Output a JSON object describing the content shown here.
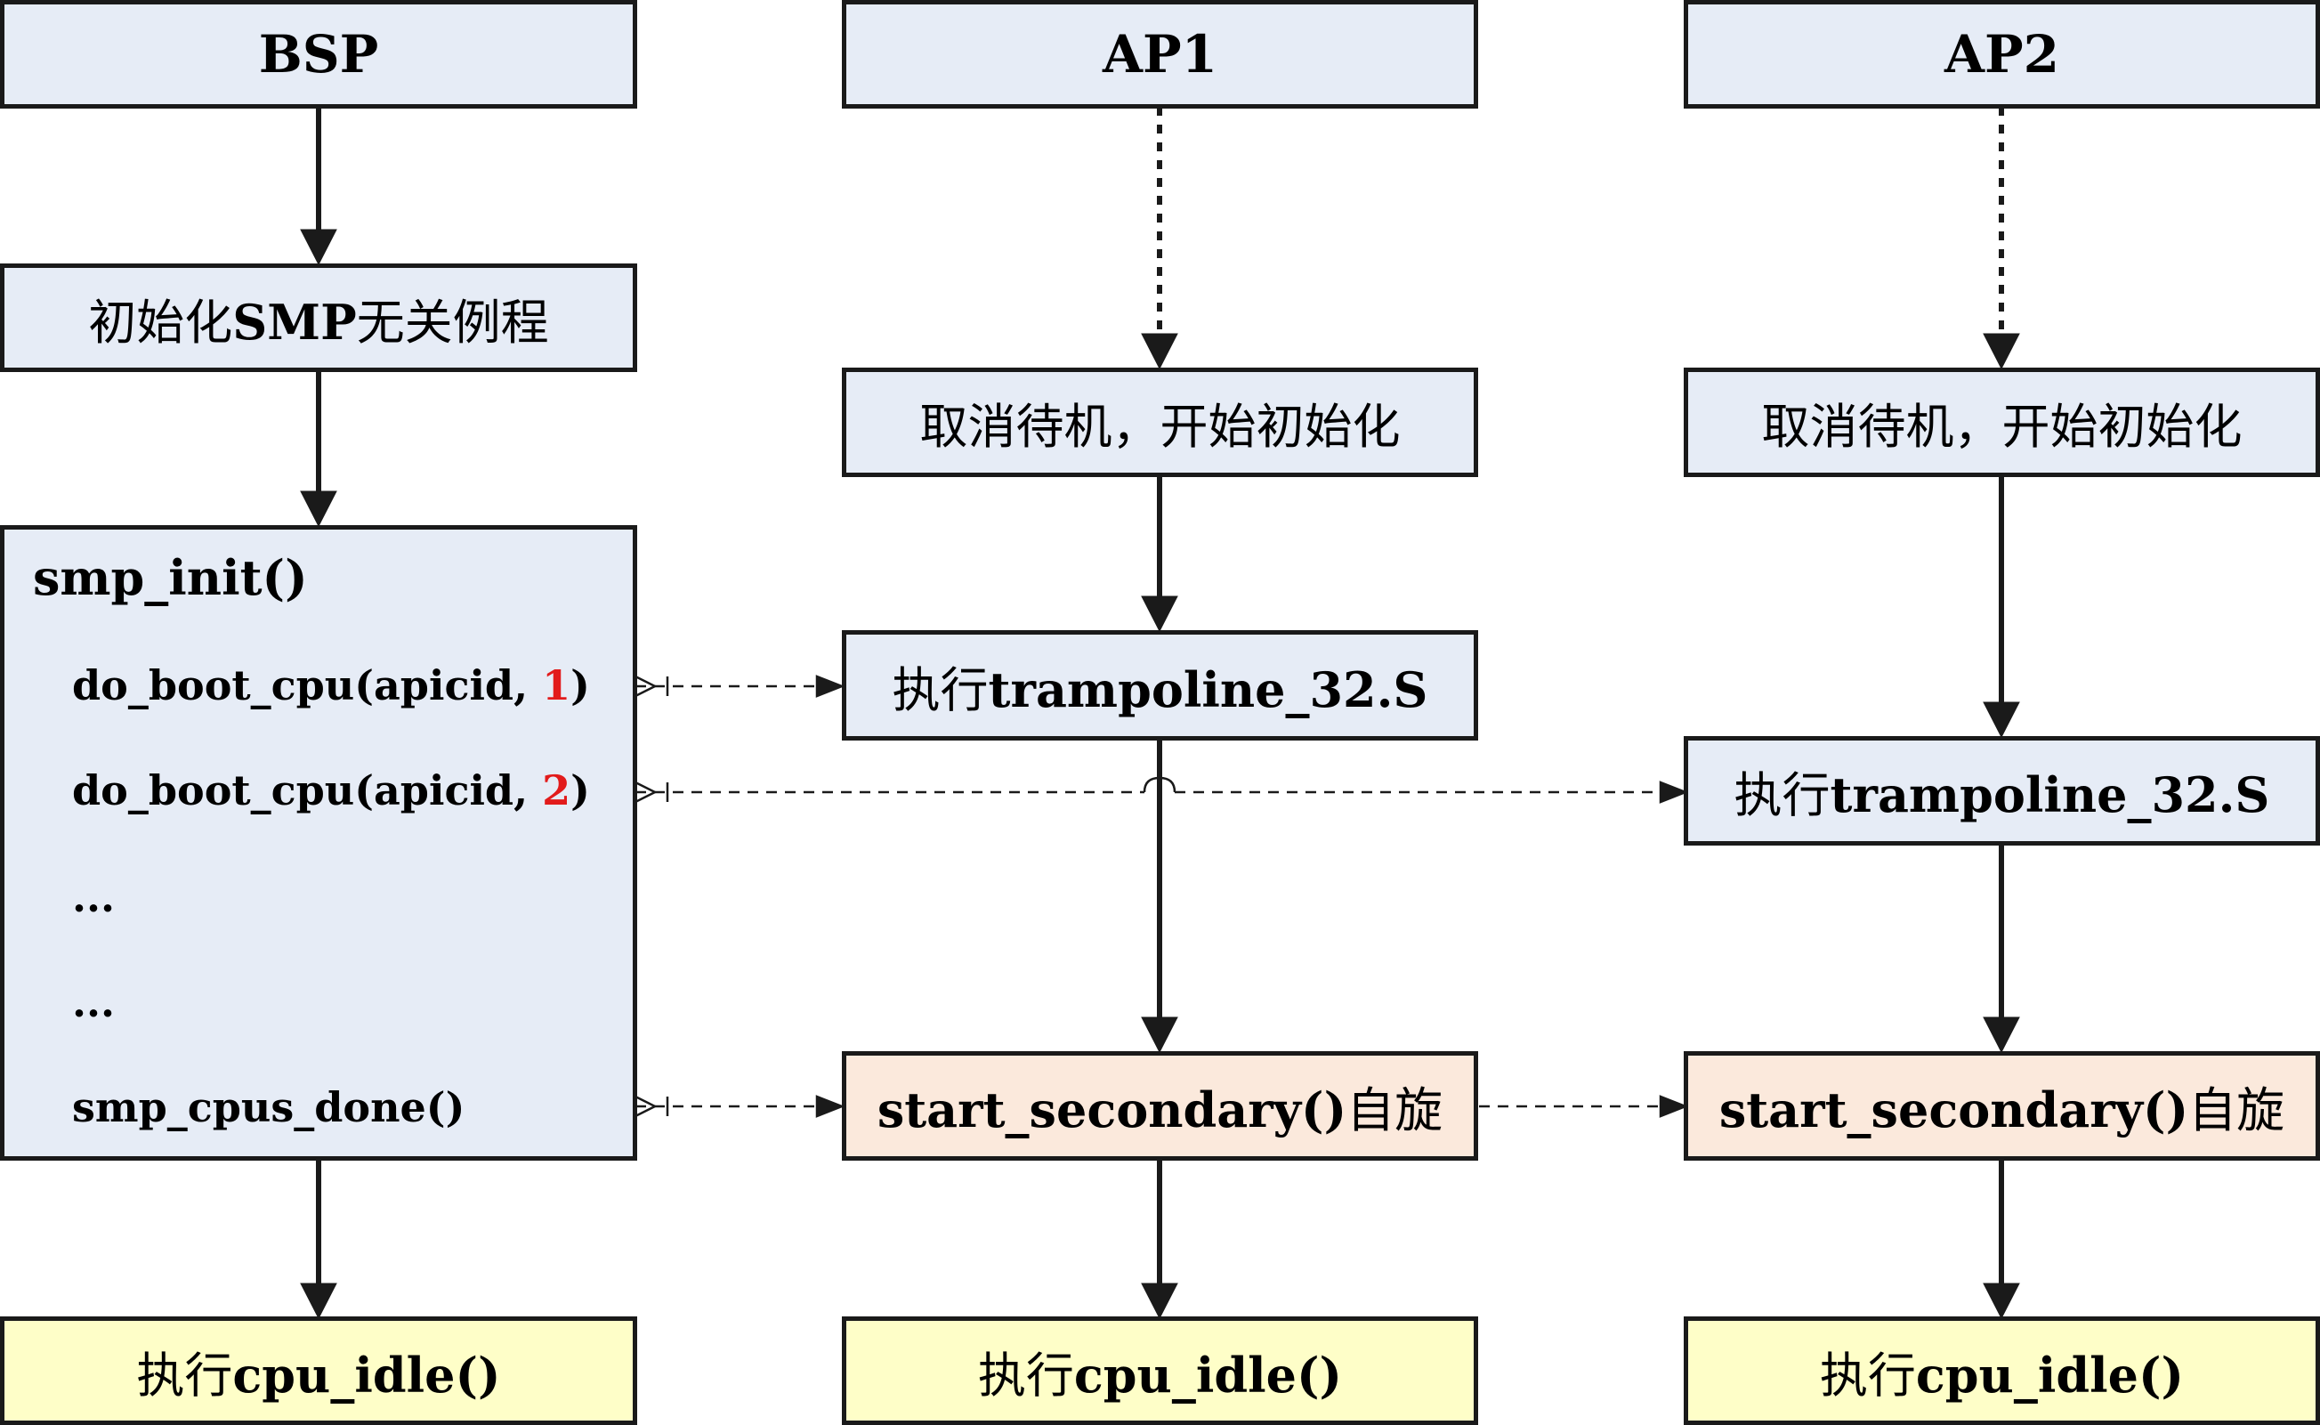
{
  "columns": {
    "bsp": {
      "header": "BSP",
      "init_step": {
        "cn": "初始化",
        "bold": "SMP",
        "cn2": "无关例程"
      },
      "block": {
        "title": "smp_init()",
        "lines": [
          {
            "pre": "do_boot_cpu(apicid, ",
            "num": "1",
            "post": ")"
          },
          {
            "pre": "do_boot_cpu(apicid, ",
            "num": "2",
            "post": ")"
          },
          {
            "text": "..."
          },
          {
            "text": "..."
          },
          {
            "text": "smp_cpus_done()"
          }
        ]
      },
      "idle": {
        "cn": "执行",
        "bold": "cpu_idle()"
      }
    },
    "ap1": {
      "header": "AP1",
      "wake": "取消待机，开始初始化",
      "tramp": {
        "cn": "执行",
        "bold": "trampoline_32.S"
      },
      "spin": {
        "bold": "start_secondary()",
        "cn": "自旋"
      },
      "idle": {
        "cn": "执行",
        "bold": "cpu_idle()"
      }
    },
    "ap2": {
      "header": "AP2",
      "wake": "取消待机，开始初始化",
      "tramp": {
        "cn": "执行",
        "bold": "trampoline_32.S"
      },
      "spin": {
        "bold": "start_secondary()",
        "cn": "自旋"
      },
      "idle": {
        "cn": "执行",
        "bold": "cpu_idle()"
      }
    }
  },
  "colors": {
    "box_blue": "#e6ecf6",
    "box_orange": "#fbe9dc",
    "box_yellow": "#fefec8",
    "highlight_number": "#e21b1b",
    "stroke": "#1a1a1a"
  }
}
